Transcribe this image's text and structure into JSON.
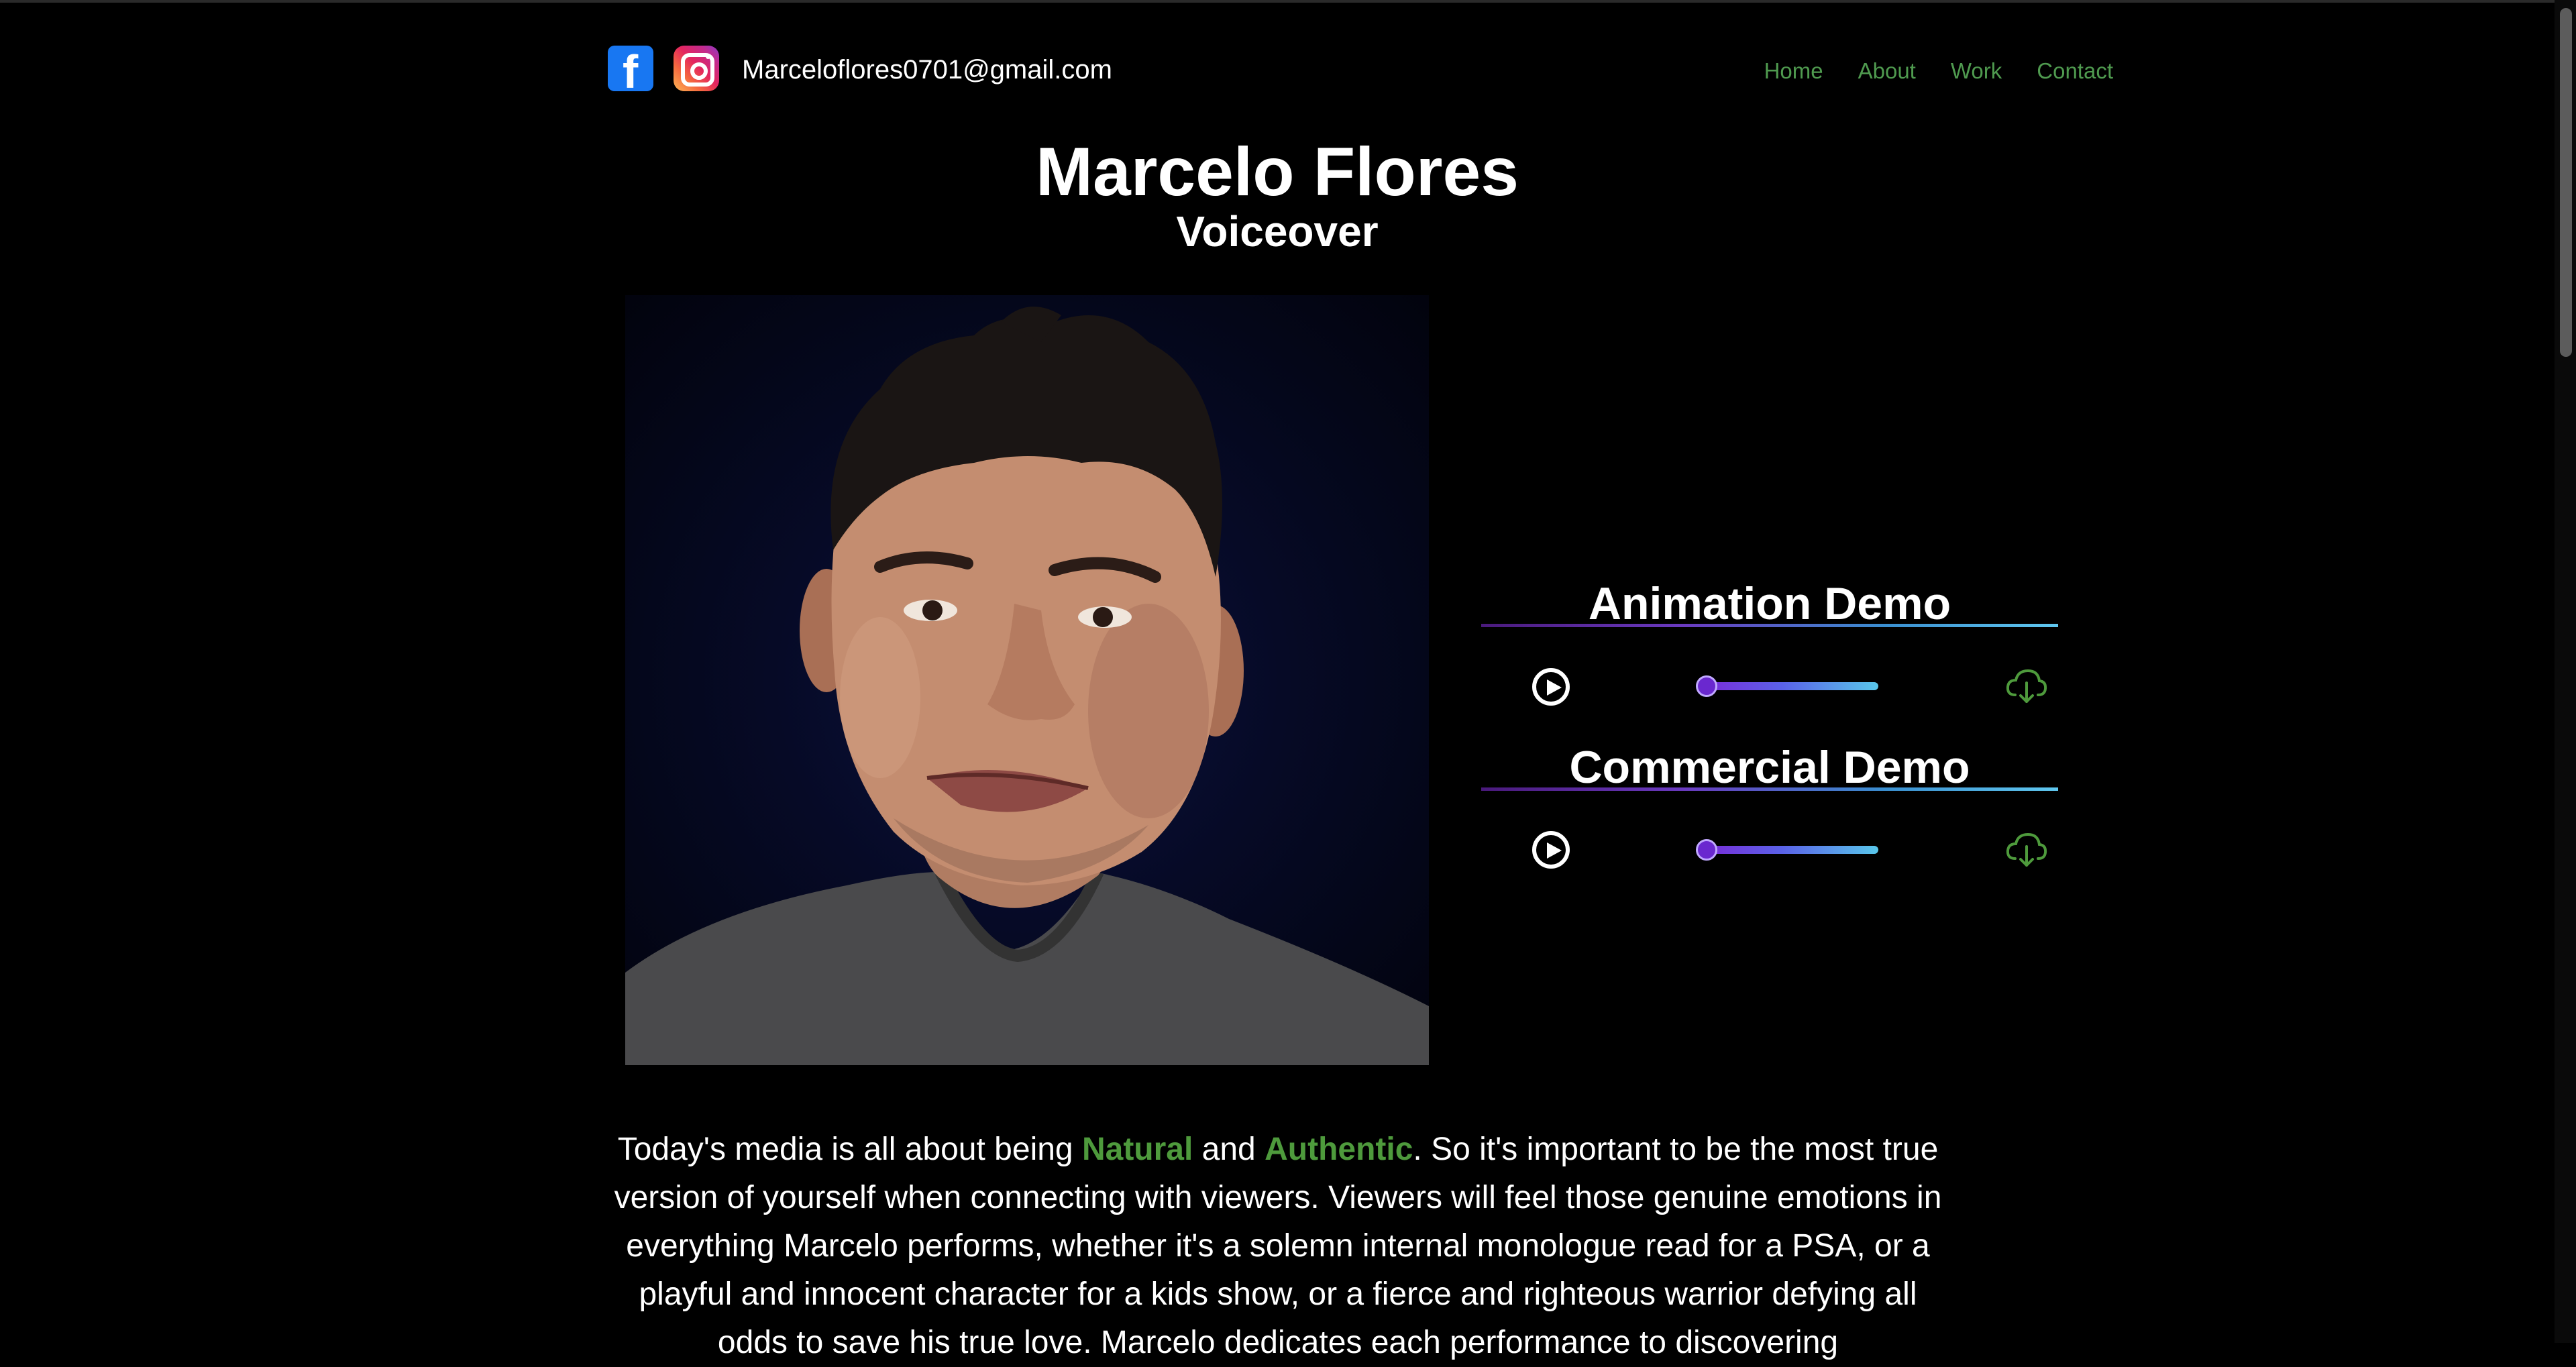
{
  "header": {
    "email": "Marceloflores0701@gmail.com",
    "social": [
      {
        "name": "facebook-icon",
        "glyph": "f"
      },
      {
        "name": "instagram-icon"
      }
    ]
  },
  "nav": {
    "items": [
      "Home",
      "About",
      "Work",
      "Contact"
    ],
    "color": "#4f9a4f"
  },
  "hero": {
    "title": "Marcelo Flores",
    "subtitle": "Voiceover"
  },
  "demos": [
    {
      "title": "Animation Demo",
      "progress": 0
    },
    {
      "title": "Commercial Demo",
      "progress": 0
    }
  ],
  "bio": {
    "part1": "Today's media is all about being ",
    "highlight1": "Natural",
    "part2": " and ",
    "highlight2": "Authentic",
    "part3": ". So it's important to be the most true version of yourself when connecting with viewers. Viewers will feel those genuine emotions in everything Marcelo performs, whether it's a solemn internal monologue read for a PSA, or a playful and innocent character for a kids show, or a fierce and righteous warrior defying all odds to save his true love. Marcelo dedicates each performance to discovering"
  },
  "colors": {
    "accent_green": "#4e9a3c",
    "background": "#000000",
    "progress_purple": "#6b2cd3",
    "progress_blue": "#59c7ea"
  }
}
